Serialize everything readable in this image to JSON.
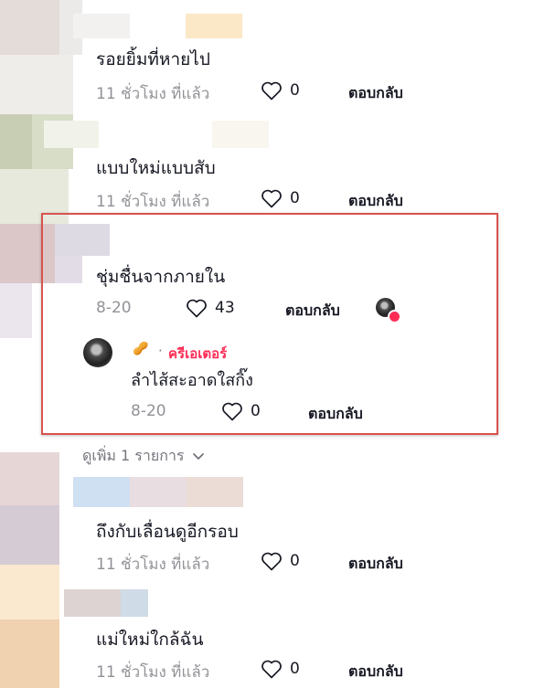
{
  "colors": {
    "accent": "#fe2c55",
    "highlight_border": "#d9534f",
    "text": "#161823"
  },
  "comments": [
    {
      "text": "รอยยิ้มที่หายไป",
      "time": "11 ชั่วโมง ที่แล้ว",
      "likes": "0",
      "reply": "ตอบกลับ"
    },
    {
      "text": "แบบใหม่แบบสับ",
      "time": "11 ชั่วโมง ที่แล้ว",
      "likes": "0",
      "reply": "ตอบกลับ"
    },
    {
      "text": "ชุ่มชื่นจากภายใน",
      "time": "8-20",
      "likes": "43",
      "reply": "ตอบกลับ"
    },
    {
      "text": "ถึงกับเลื่อนดูอีกรอบ",
      "time": "11 ชั่วโมง ที่แล้ว",
      "likes": "0",
      "reply": "ตอบกลับ"
    },
    {
      "text": "แม่ใหม่ใกล้ฉัน",
      "time": "11 ชั่วโมง ที่แล้ว",
      "likes": "0",
      "reply": "ตอบกลับ"
    }
  ],
  "creator_reply": {
    "separator": "·",
    "badge": "ครีเอเตอร์",
    "emoji": "🥜",
    "text": "ลำไส้สะอาดใสกิ๊ง",
    "time": "8-20",
    "likes": "0",
    "reply": "ตอบกลับ"
  },
  "see_more": {
    "label": "ดูเพิ่ม 1 รายการ",
    "icon": "chevron-down-icon"
  }
}
